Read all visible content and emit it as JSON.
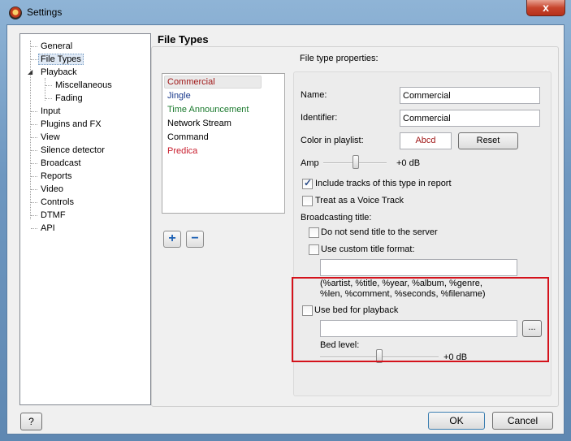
{
  "window": {
    "title": "Settings",
    "close_label": "x"
  },
  "tree": {
    "items": [
      {
        "label": "General"
      },
      {
        "label": "File Types"
      },
      {
        "label": "Playback"
      },
      {
        "label": "Miscellaneous"
      },
      {
        "label": "Fading"
      },
      {
        "label": "Input"
      },
      {
        "label": "Plugins and FX"
      },
      {
        "label": "View"
      },
      {
        "label": "Silence detector"
      },
      {
        "label": "Broadcast"
      },
      {
        "label": "Reports"
      },
      {
        "label": "Video"
      },
      {
        "label": "Controls"
      },
      {
        "label": "DTMF"
      },
      {
        "label": "API"
      }
    ],
    "selected": "File Types"
  },
  "panel": {
    "title": "File Types",
    "file_types": [
      {
        "label": "Commercial",
        "color": "#a01818"
      },
      {
        "label": "Jingle",
        "color": "#1a3a8c"
      },
      {
        "label": "Time Announcement",
        "color": "#1b7a2e"
      },
      {
        "label": "Network Stream",
        "color": "#000000"
      },
      {
        "label": "Command",
        "color": "#000000"
      },
      {
        "label": "Predica",
        "color": "#c81c2c"
      }
    ],
    "add_label": "+",
    "remove_label": "−"
  },
  "props": {
    "header": "File type properties:",
    "name_label": "Name:",
    "name_value": "Commercial",
    "identifier_label": "Identifier:",
    "identifier_value": "Commercial",
    "color_label": "Color in playlist:",
    "color_sample": "Abcd",
    "color_sample_color": "#a01818",
    "reset_label": "Reset",
    "amp_label": "Amp",
    "amp_value": "+0 dB",
    "include_label": "Include tracks of this type in report",
    "include_checked": true,
    "voice_label": "Treat as a Voice Track",
    "voice_checked": false,
    "broadcast_label": "Broadcasting title:",
    "no_send_label": "Do not send title to the server",
    "custom_title_label": "Use custom title format:",
    "custom_title_value": "",
    "format_hint_1": "(%artist, %title, %year, %album, %genre,",
    "format_hint_2": "%len, %comment, %seconds, %filename)",
    "use_bed_label": "Use bed for playback",
    "bed_path_value": "",
    "browse_label": "...",
    "bed_level_label": "Bed level:",
    "bed_level_value": "+0 dB"
  },
  "footer": {
    "help_label": "?",
    "ok_label": "OK",
    "cancel_label": "Cancel"
  },
  "colors": {
    "highlight": "#d4121b"
  }
}
